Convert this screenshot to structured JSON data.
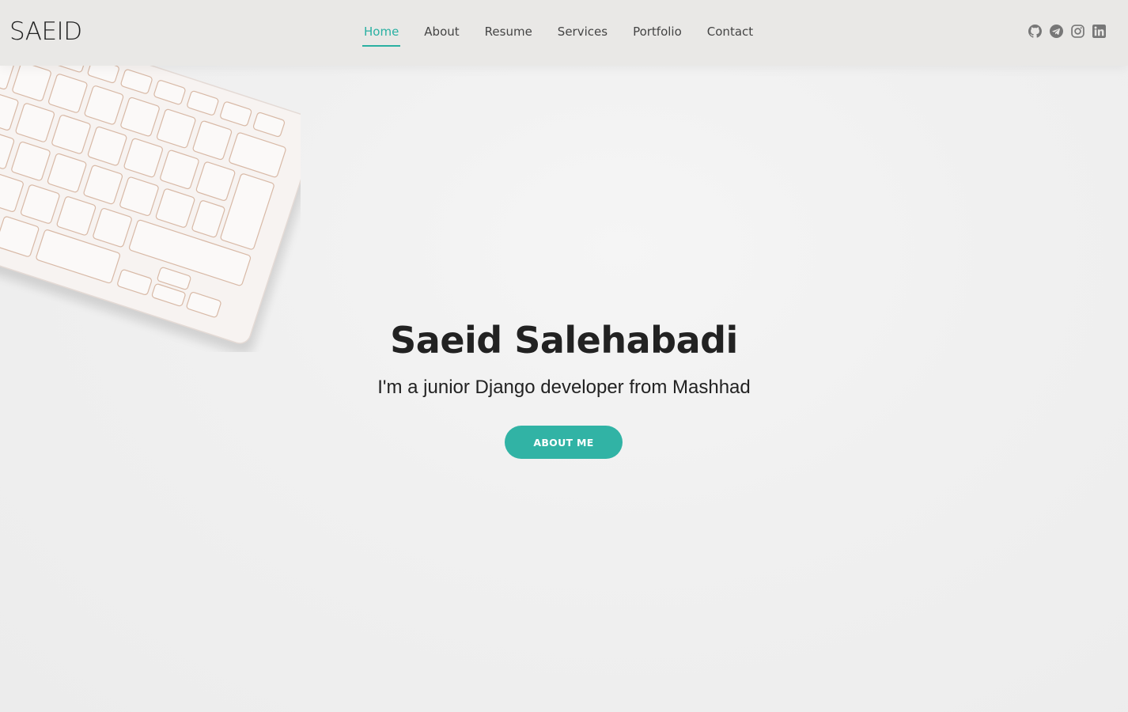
{
  "header": {
    "logo": "SAEID",
    "nav": [
      {
        "label": "Home",
        "active": true
      },
      {
        "label": "About",
        "active": false
      },
      {
        "label": "Resume",
        "active": false
      },
      {
        "label": "Services",
        "active": false
      },
      {
        "label": "Portfolio",
        "active": false
      },
      {
        "label": "Contact",
        "active": false
      }
    ],
    "socials": [
      "github-icon",
      "telegram-icon",
      "instagram-icon",
      "linkedin-icon"
    ]
  },
  "hero": {
    "title": "Saeid Salehabadi",
    "subtitle": "I'm a junior Django developer from Mashhad",
    "button_label": "ABOUT ME",
    "decoration": "keyboard-image"
  },
  "colors": {
    "accent": "#2ab0a2",
    "button": "#31b3a5",
    "header_bg": "#e9e8e6",
    "page_bg": "#efefef",
    "text": "#222222",
    "icon": "#777777"
  }
}
